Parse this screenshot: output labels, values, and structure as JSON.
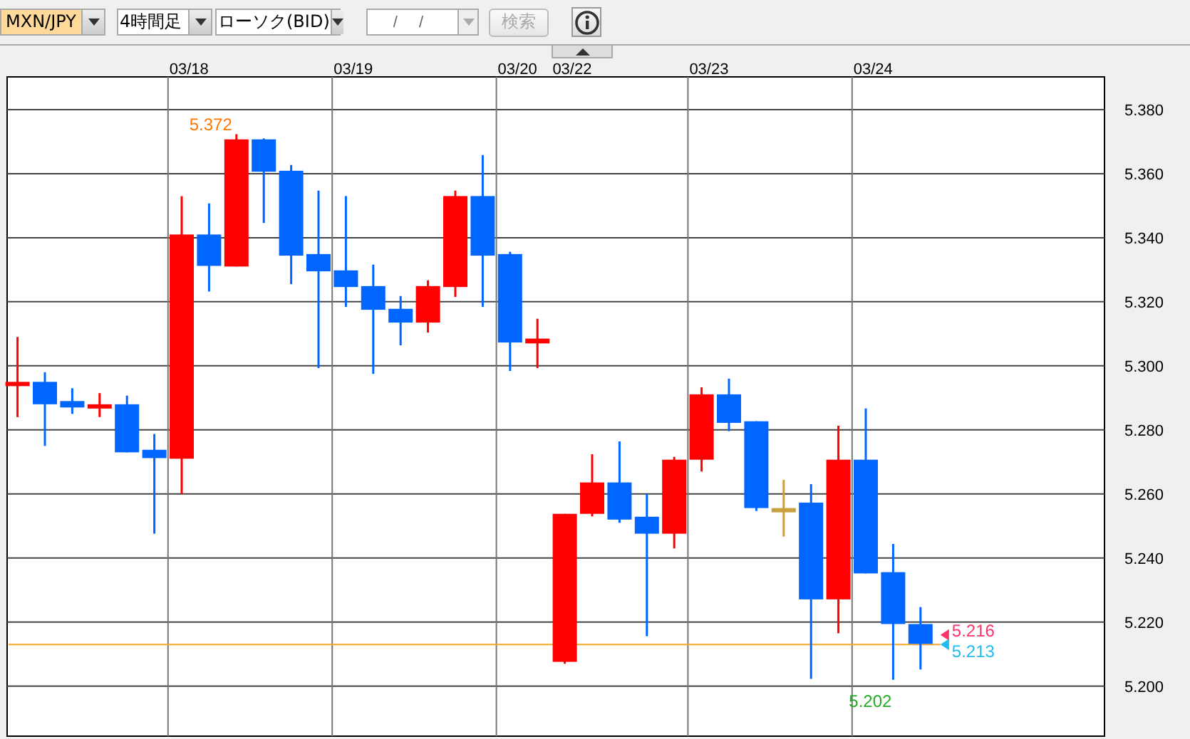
{
  "toolbar": {
    "pair_select": {
      "value": "MXN/JPY"
    },
    "period_select": {
      "value": "4時間足"
    },
    "type_select": {
      "value": "ローソク(BID)"
    },
    "date_field": {
      "placeholder": "/ /"
    },
    "search_button": {
      "label": "検索",
      "disabled": true
    }
  },
  "chart": {
    "date_labels": [
      "03/18",
      "03/19",
      "03/20",
      "03/22",
      "03/23",
      "03/24"
    ],
    "price_labels": [
      "5.380",
      "5.360",
      "5.340",
      "5.320",
      "5.300",
      "5.280",
      "5.260",
      "5.240",
      "5.220",
      "5.200"
    ],
    "high_label": "5.372",
    "low_label": "5.202",
    "price_markers": [
      {
        "label": "5.216",
        "color": "#ff3366"
      },
      {
        "label": "5.213",
        "color": "#22bbee"
      }
    ]
  }
}
